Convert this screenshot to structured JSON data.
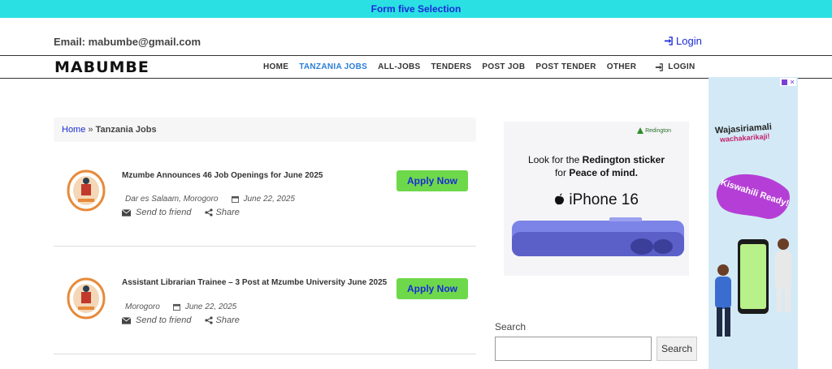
{
  "topbar": {
    "link": "Form five Selection"
  },
  "header": {
    "email": "Email: mabumbe@gmail.com",
    "login": "Login"
  },
  "nav": {
    "logo": "MABUMBE",
    "items": [
      "HOME",
      "TANZANIA JOBS",
      "ALL-JOBS",
      "TENDERS",
      "POST JOB",
      "POST TENDER",
      "OTHER"
    ],
    "active": "TANZANIA JOBS",
    "login": "LOGIN"
  },
  "breadcrumb": {
    "home": "Home",
    "sep": "»",
    "current": "Tanzania Jobs"
  },
  "jobs": [
    {
      "title": "Mzumbe Announces 46 Job Openings for June 2025",
      "location": "Dar es Salaam, Morogoro",
      "date": "June 22, 2025",
      "apply": "Apply Now",
      "send": "Send to friend",
      "share": "Share"
    },
    {
      "title": "Assistant Librarian Trainee – 3 Post at Mzumbe University June 2025",
      "location": "Morogoro",
      "date": "June 22, 2025",
      "apply": "Apply Now",
      "send": "Send to friend",
      "share": "Share"
    }
  ],
  "ad_mid": {
    "brand": "Redington",
    "line1_a": "Look for the ",
    "line1_b": "Redington sticker",
    "line2_a": "for ",
    "line2_b": "Peace of mind.",
    "product": "iPhone 16"
  },
  "search": {
    "label": "Search",
    "value": "",
    "button": "Search"
  },
  "ad_side": {
    "headline1": "Wajasiriamali",
    "headline2": "wachakarikaji!",
    "badge": "Kiswahili Ready!"
  },
  "colors": {
    "topbar": "#2ae0e3",
    "link": "#1a2bd6",
    "apply": "#6ed84b",
    "active_nav": "#2a7ed8"
  }
}
